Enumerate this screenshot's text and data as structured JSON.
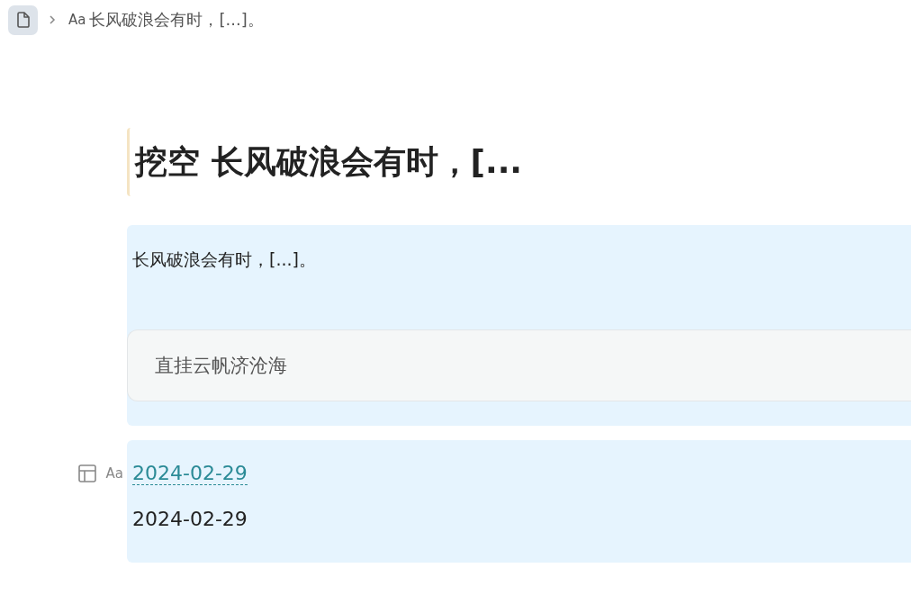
{
  "breadcrumb": {
    "prefix": "Aa",
    "title": "长风破浪会有时，[...]。"
  },
  "page_title": "挖空 长风破浪会有时，[...",
  "blocks": [
    {
      "kind": "quote",
      "text": "长风破浪会有时，[...]。",
      "answer": "直挂云帆济沧海"
    },
    {
      "kind": "date",
      "prefix": "Aa",
      "link": "2024-02-29",
      "value": "2024-02-29"
    }
  ]
}
